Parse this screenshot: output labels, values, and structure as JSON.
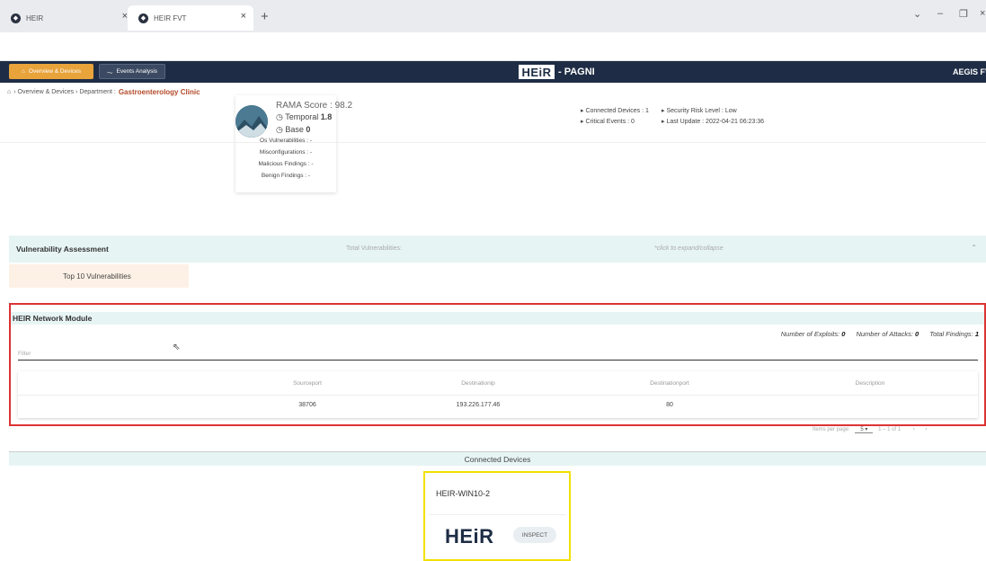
{
  "browser": {
    "tabs": [
      {
        "title": "HEIR"
      },
      {
        "title": "HEIR FVT"
      }
    ],
    "new_tab_symbol": "+",
    "close_symbol": "×",
    "window_controls": {
      "dropdown": "⌄",
      "minimize": "–",
      "restore": "❐",
      "close": "×"
    }
  },
  "appbar": {
    "overview_label": "Overview & Devices",
    "events_label": "Events Analysis",
    "logo_text": "HEiR",
    "subtitle": "- PAGNI",
    "right_label": "AEGIS FV",
    "background_color": "#1e2d45",
    "accent_color": "#e8a33b"
  },
  "breadcrumb": {
    "home_icon": "home-icon",
    "trail": "› Overview & Devices › Department :",
    "department": "Gastroenterology Clinic"
  },
  "rama": {
    "score_label": "RAMA Score : 98.2",
    "temporal_label": "Temporal",
    "temporal_value": "1.8",
    "base_label": "Base",
    "base_value": "0",
    "stats": [
      "Os Vulnerabilities : -",
      "Misconfigurations : -",
      "Malicious Findings : -",
      "Benign Findings : -"
    ]
  },
  "summary": {
    "connected_devices": "Connected Devices : 1",
    "critical_events": "Critical Events : 0",
    "security_risk": "Security Risk Level : Low",
    "last_update": "Last Update : 2022-04-21 06:23:36"
  },
  "vulnerability": {
    "title": "Vulnerability Assessment",
    "total_label": "Total Vulnerabilities:",
    "expand_hint": "*click to expand/collapse",
    "top10_label": "Top 10 Vulnerabilities"
  },
  "network_module": {
    "title": "HEIR Network Module",
    "exploits_label": "Number of Exploits:",
    "exploits_value": "0",
    "attacks_label": "Number of Attacks:",
    "attacks_value": "0",
    "findings_label": "Total Findings:",
    "findings_value": "1",
    "filter_placeholder": "Filter",
    "columns": [
      "Sourceport",
      "Destinationip",
      "Destinationport",
      "Description"
    ],
    "rows": [
      [
        "38706",
        "193.226.177.46",
        "80",
        ""
      ]
    ],
    "highlight_color": "#dd3333"
  },
  "pager": {
    "items_per_page_label": "Items per page:",
    "items_per_page_value": "5",
    "range": "1 – 1 of 1",
    "prev": "‹",
    "next": "›"
  },
  "connected_devices": {
    "title": "Connected Devices",
    "device": {
      "name": "HEIR-WIN10-2",
      "logo_text": "HEiR",
      "inspect_label": "INSPECT",
      "highlight_color": "#f0e000"
    }
  }
}
